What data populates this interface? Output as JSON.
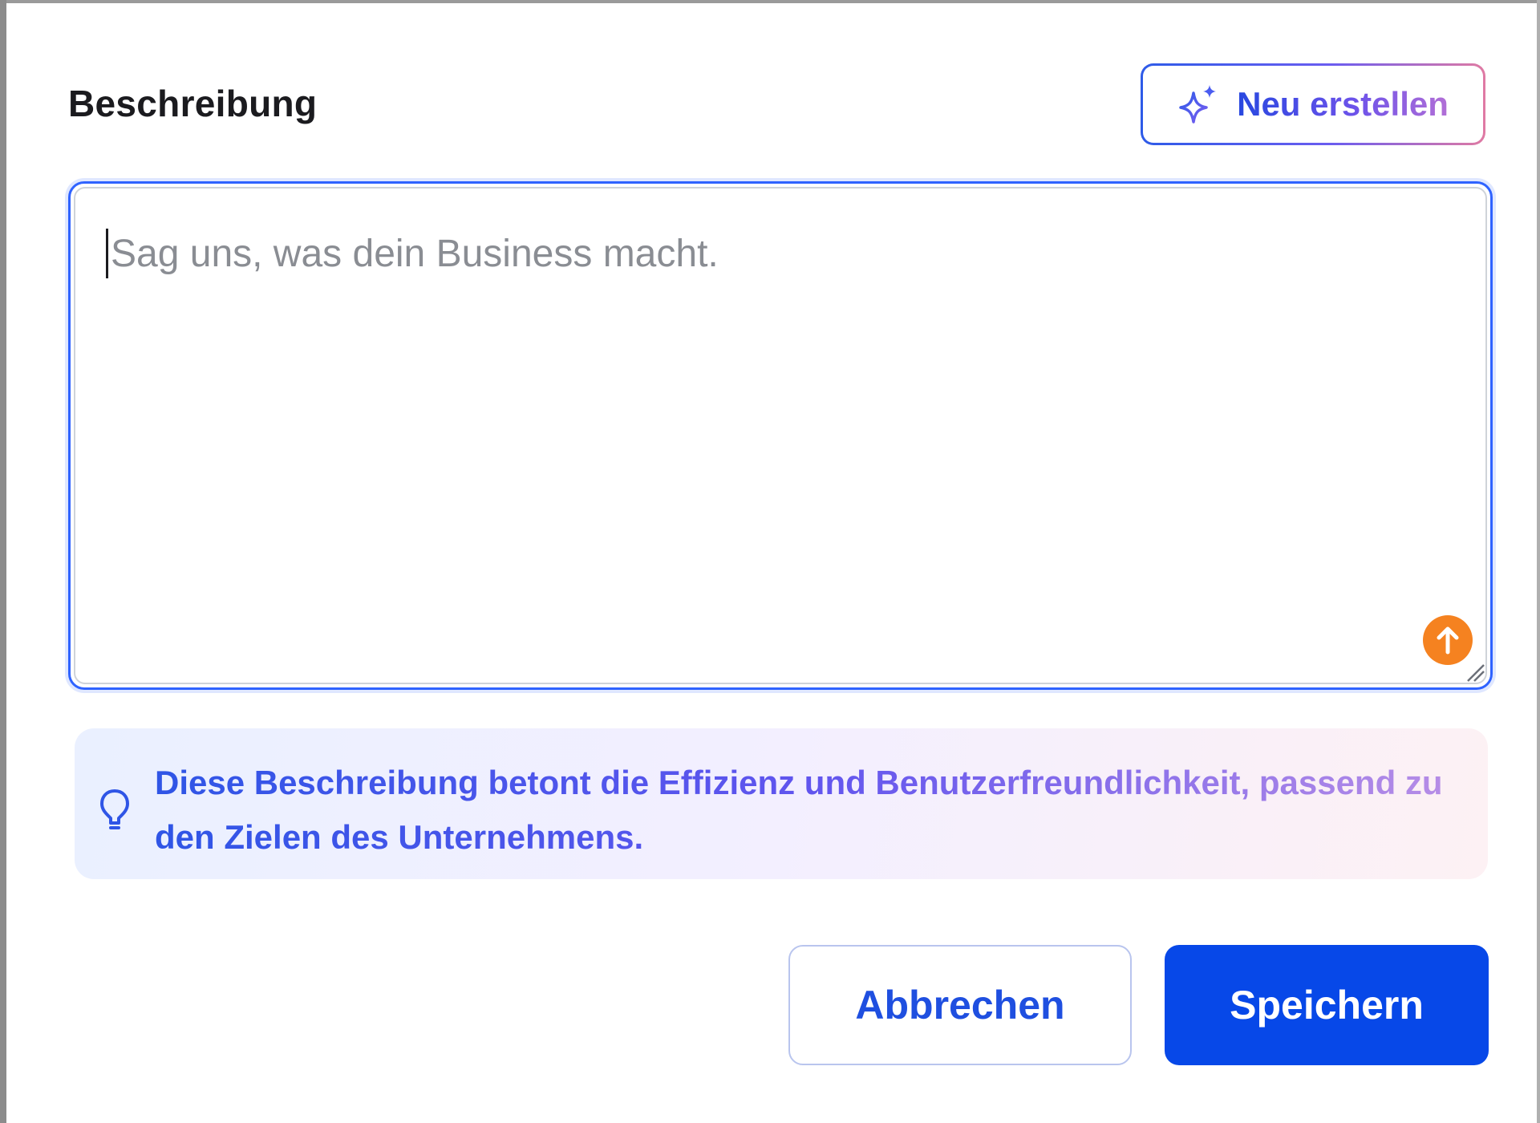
{
  "section": {
    "title": "Beschreibung"
  },
  "regenerate_button": {
    "label": "Neu erstellen",
    "icon": "sparkle-icon"
  },
  "description_field": {
    "value": "",
    "placeholder": "Sag uns, was dein Business macht.",
    "upload_icon": "arrow-up-icon"
  },
  "tip": {
    "icon": "lightbulb-icon",
    "text": "Diese Beschreibung betont die Effizienz und Benutzerfreundlichkeit, passend zu den Zielen des Unternehmens."
  },
  "actions": {
    "cancel_label": "Abbrechen",
    "save_label": "Speichern"
  },
  "colors": {
    "primary": "#0748e8",
    "focus_border": "#2f63ff",
    "upload_accent": "#f58220"
  }
}
